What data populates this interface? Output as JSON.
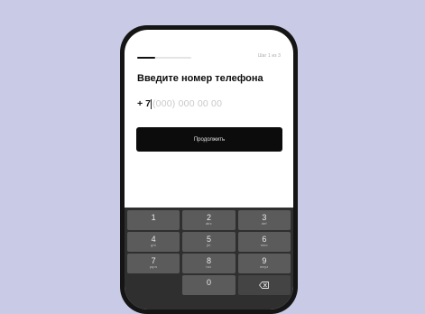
{
  "onboarding": {
    "step_label": "Шаг 1 из 3",
    "progress": 0.33,
    "title": "Введите номер телефона"
  },
  "phone_input": {
    "prefix": "+",
    "country_code": "7",
    "placeholder": "(000) 000 00 00"
  },
  "continue_button": {
    "label": "Продолжить"
  },
  "keyboard": {
    "keys": [
      {
        "digit": "1",
        "letters": ""
      },
      {
        "digit": "2",
        "letters": "abc"
      },
      {
        "digit": "3",
        "letters": "def"
      },
      {
        "digit": "4",
        "letters": "ghi"
      },
      {
        "digit": "5",
        "letters": "jkl"
      },
      {
        "digit": "6",
        "letters": "mno"
      },
      {
        "digit": "7",
        "letters": "pqrs"
      },
      {
        "digit": "8",
        "letters": "tuv"
      },
      {
        "digit": "9",
        "letters": "wxyz"
      },
      {
        "digit": "0",
        "letters": ""
      }
    ],
    "delete_icon": "backspace-icon"
  },
  "colors": {
    "background": "#c8cae6",
    "device_frame": "#151515",
    "button": "#0c0c0c",
    "keyboard": "#2f2f2f",
    "key": "#5b5b5b"
  }
}
